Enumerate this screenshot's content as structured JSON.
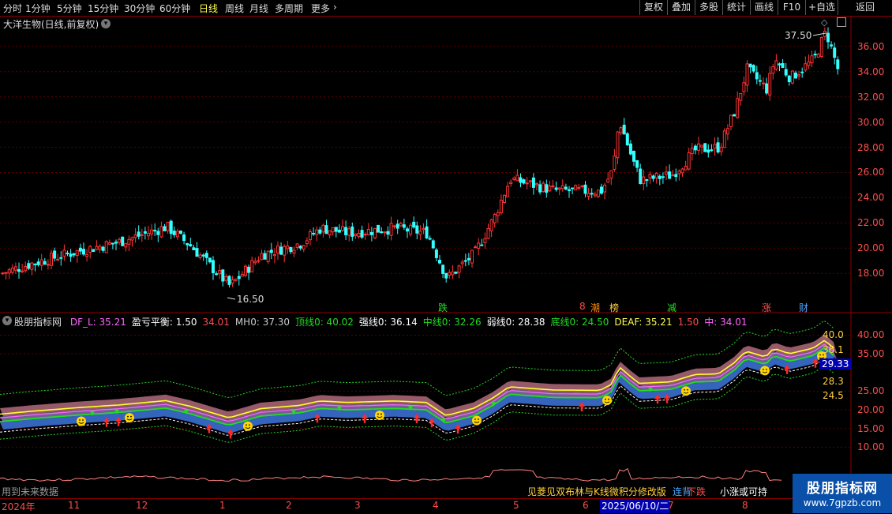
{
  "toolbar": {
    "periods": [
      "分时",
      "1分钟",
      "5分钟",
      "15分钟",
      "30分钟",
      "60分钟",
      "日线",
      "周线",
      "月线",
      "多周期",
      "更多"
    ],
    "active_period": "日线",
    "right_buttons": [
      "复权",
      "叠加",
      "多股",
      "统计",
      "画线",
      "F10",
      "+自选",
      "返回"
    ]
  },
  "stock": {
    "title": "大洋生物(日线,前复权)"
  },
  "main_chart": {
    "y_ticks": [
      "36.00",
      "34.00",
      "32.00",
      "30.00",
      "28.00",
      "26.00",
      "24.00",
      "22.00",
      "20.00",
      "18.00"
    ],
    "high_label": "37.50",
    "low_label": "16.50",
    "signals": [
      {
        "text": "跌",
        "color": "#22dd22"
      },
      {
        "text": "8",
        "color": "#ff4d4d"
      },
      {
        "text": "潮",
        "color": "#ff8c00"
      },
      {
        "text": "榜",
        "color": "#ffd040"
      },
      {
        "text": "减",
        "color": "#22dd22"
      },
      {
        "text": "涨",
        "color": "#ff4d4d"
      },
      {
        "text": "财",
        "color": "#4da6ff"
      }
    ]
  },
  "indicator": {
    "name": "股朋指标网",
    "legend": [
      {
        "label": "DF_L: 35.21",
        "color": "#ff66ff"
      },
      {
        "label": "盈亏平衡: 1.50",
        "color": "#ffffff"
      },
      {
        "label": "34.01",
        "color": "#ff4d4d"
      },
      {
        "label": "MH0: 37.30",
        "color": "#cccccc"
      },
      {
        "label": "顶线0: 40.02",
        "color": "#22dd22"
      },
      {
        "label": "强线0: 36.14",
        "color": "#ffffff"
      },
      {
        "label": "中线0: 32.26",
        "color": "#22dd22"
      },
      {
        "label": "弱线0: 28.38",
        "color": "#ffffff"
      },
      {
        "label": "底线0: 24.50",
        "color": "#22dd22"
      },
      {
        "label": "DEAF: 35.21",
        "color": "#ffff4d"
      },
      {
        "label": "1.50",
        "color": "#ff4d4d"
      },
      {
        "label": "中: 34.01",
        "color": "#ff66ff"
      }
    ],
    "y_ticks": [
      "40.00",
      "35.00",
      "25.00",
      "20.00",
      "15.00",
      "10.00"
    ],
    "right_values": {
      "top": "40.0",
      "strong": "36.1",
      "current": "29.33",
      "weak": "28.3",
      "bottom": "24.5"
    },
    "bottom_texts": [
      {
        "text": "用到未来数据",
        "color": "#999999"
      },
      {
        "text": "见菱见双布林与K线微积分修改版",
        "color": "#ffd040"
      },
      {
        "text": "连背",
        "color": "#4da6ff"
      },
      {
        "text": "下跌",
        "color": "#ff4d4d"
      },
      {
        "text": "小涨或可持",
        "color": "#ffffff"
      }
    ]
  },
  "date_axis": {
    "ticks": [
      "2024年",
      "11",
      "12",
      "1",
      "2",
      "3",
      "4",
      "5",
      "6",
      "7",
      "8"
    ],
    "cursor_date": "2025/06/10/二"
  },
  "logo": {
    "line1": "股朋指标网",
    "line2": "www.7gpzb.com"
  },
  "colors": {
    "up": "#ff3333",
    "down": "#33ffff",
    "axis": "#8b0000",
    "grid": "#5a0000"
  }
}
